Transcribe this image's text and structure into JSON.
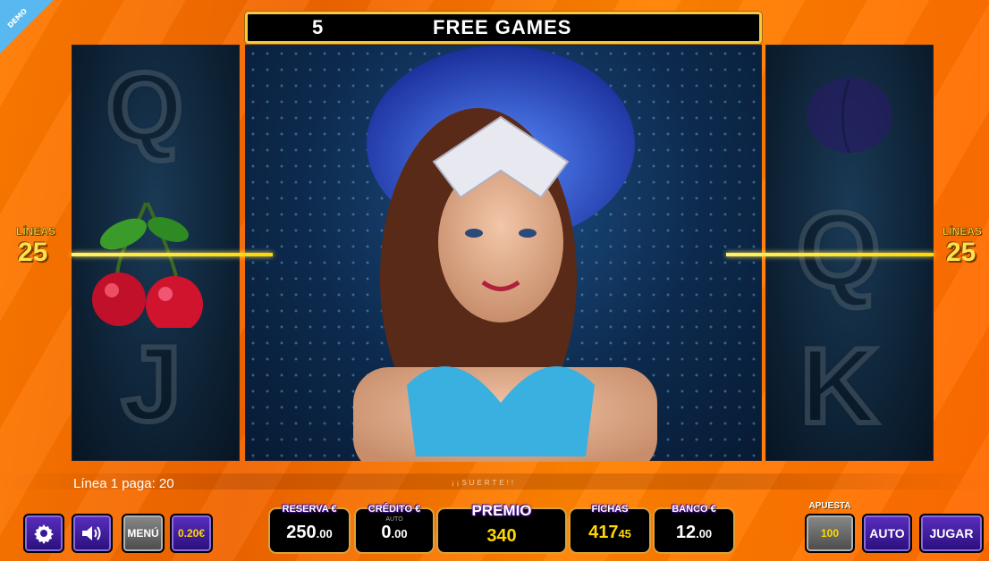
{
  "banner": {
    "free_count": "5",
    "free_label": "FREE GAMES"
  },
  "demo_badge": "DEMO",
  "lineas": {
    "label": "LÍNEAS",
    "value": "25"
  },
  "reels": {
    "left": {
      "top": "Q",
      "middle": "cherries-icon",
      "bottom": "J"
    },
    "right": {
      "top": "plum-icon",
      "middle": "Q",
      "bottom": "K"
    },
    "center": "showgirl-feathers-icon"
  },
  "pay_info": "Línea 1 paga: 20",
  "suerte": "¡¡SUERTE!!",
  "controls": {
    "settings_icon": "gear-icon",
    "sound_icon": "speaker-icon",
    "menu_label": "MENÚ",
    "coin_value": "0.20€",
    "auto_label": "AUTO",
    "play_label": "JUGAR",
    "bet_label": "APUESTA",
    "bet_value": "100"
  },
  "stats": {
    "reserva": {
      "label": "RESERVA €",
      "main": "250",
      "cents": ".00"
    },
    "credito": {
      "label": "CRÉDITO €",
      "sub": "AUTO",
      "main": "0",
      "cents": ".00"
    },
    "premio": {
      "label": "PREMIO",
      "main": "340"
    },
    "fichas": {
      "label": "FICHAS",
      "main": "417",
      "cents": "45"
    },
    "banco": {
      "label": "BANCO €",
      "main": "12",
      "cents": ".00"
    }
  },
  "colors": {
    "accent_gold": "#ffe14a",
    "button_purple": "#3a1a9a",
    "background_orange": "#ff7a00",
    "premio_text": "#ffd700",
    "fichas_text": "#ffd700"
  }
}
